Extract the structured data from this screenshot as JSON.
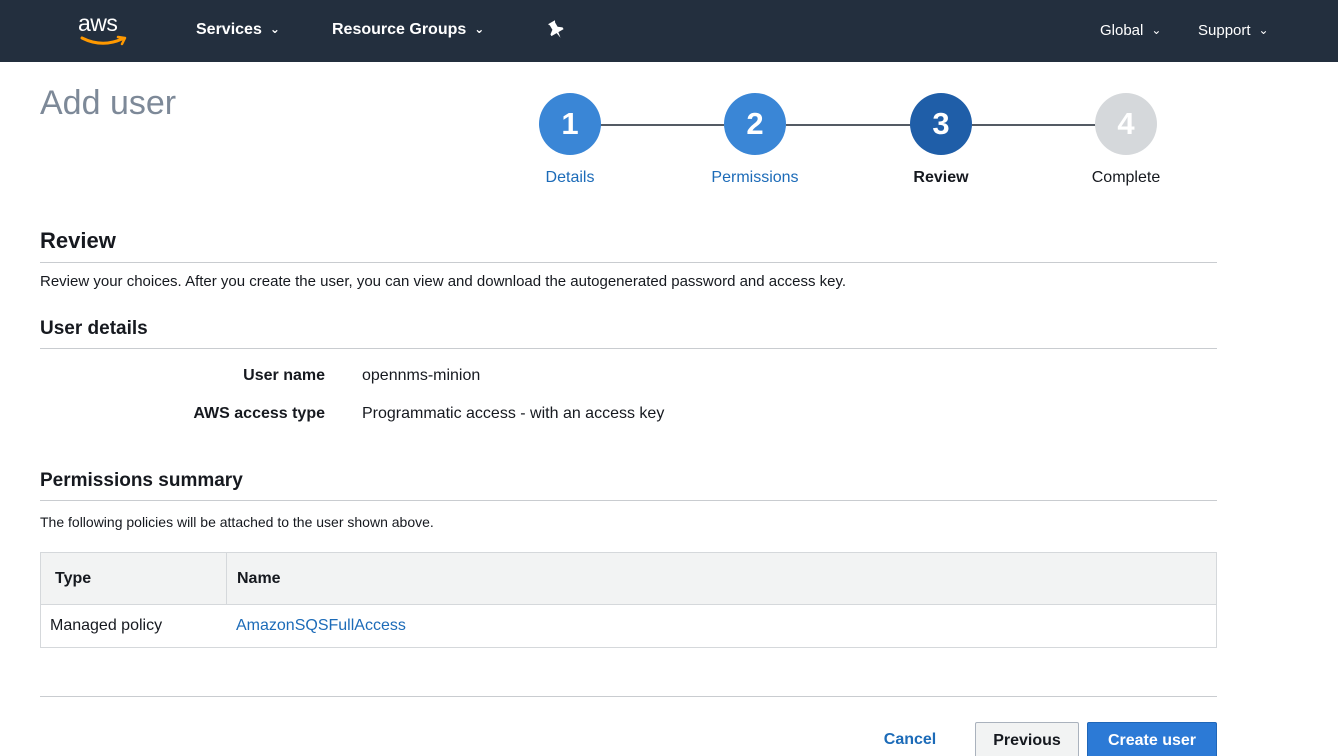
{
  "nav": {
    "logo": "aws",
    "services": "Services",
    "resource_groups": "Resource Groups",
    "region": "Global",
    "support": "Support"
  },
  "page_title": "Add user",
  "steps": [
    {
      "number": "1",
      "label": "Details",
      "state": "done"
    },
    {
      "number": "2",
      "label": "Permissions",
      "state": "done"
    },
    {
      "number": "3",
      "label": "Review",
      "state": "active"
    },
    {
      "number": "4",
      "label": "Complete",
      "state": "pending"
    }
  ],
  "review": {
    "heading": "Review",
    "intro": "Review your choices. After you create the user, you can view and download the autogenerated password and access key."
  },
  "user_details": {
    "heading": "User details",
    "user_name_label": "User name",
    "user_name_value": "opennms-minion",
    "access_type_label": "AWS access type",
    "access_type_value": "Programmatic access - with an access key"
  },
  "permissions": {
    "heading": "Permissions summary",
    "intro": "The following policies will be attached to the user shown above.",
    "columns": [
      "Type",
      "Name"
    ],
    "rows": [
      {
        "type": "Managed policy",
        "name": "AmazonSQSFullAccess"
      }
    ]
  },
  "actions": {
    "cancel": "Cancel",
    "previous": "Previous",
    "create": "Create user"
  },
  "colors": {
    "nav_bg": "#232f3e",
    "step_done": "#3a86d6",
    "step_active": "#1f5ea8",
    "step_pending": "#d5d8db",
    "link": "#1c6bb8",
    "primary": "#2c7ad6"
  }
}
